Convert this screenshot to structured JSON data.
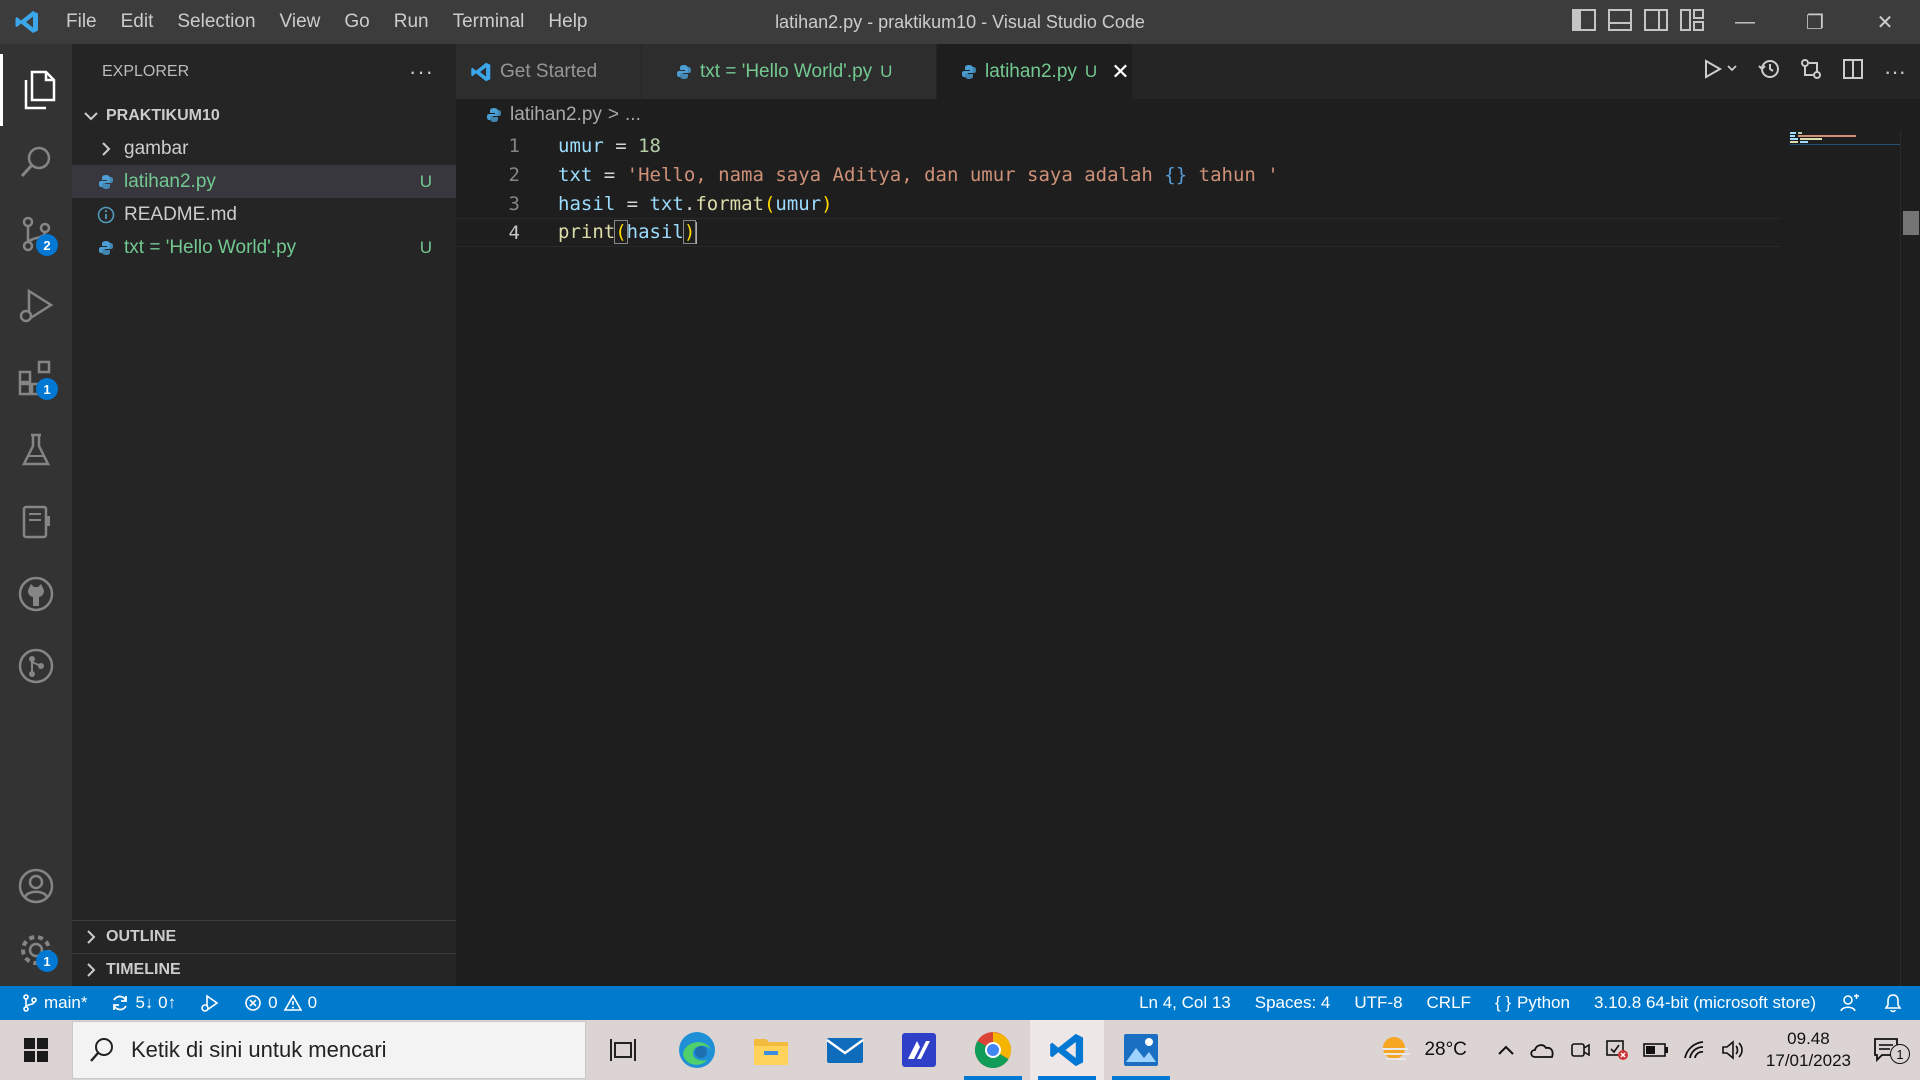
{
  "titlebar": {
    "menu": [
      "File",
      "Edit",
      "Selection",
      "View",
      "Go",
      "Run",
      "Terminal",
      "Help"
    ],
    "title": "latihan2.py - praktikum10 - Visual Studio Code",
    "window_controls": {
      "minimize": "—",
      "restore": "❐",
      "close": "✕"
    }
  },
  "activitybar": {
    "source_control_badge": "2",
    "extensions_badge": "1",
    "settings_badge": "1"
  },
  "sidebar": {
    "header": "EXPLORER",
    "more": "···",
    "root": "PRAKTIKUM10",
    "items": [
      {
        "label": "gambar",
        "status": ""
      },
      {
        "label": "latihan2.py",
        "status": "U"
      },
      {
        "label": "README.md",
        "status": ""
      },
      {
        "label": "txt = 'Hello World'.py",
        "status": "U"
      }
    ],
    "outline": "OUTLINE",
    "timeline": "TIMELINE"
  },
  "tabs": [
    {
      "label": "Get Started",
      "status": ""
    },
    {
      "label": "txt = 'Hello World'.py",
      "status": "U"
    },
    {
      "label": "latihan2.py",
      "status": "U",
      "close": "✕"
    }
  ],
  "breadcrumb": {
    "file": "latihan2.py",
    "separator": ">",
    "rest": "..."
  },
  "editor": {
    "line_numbers": [
      "1",
      "2",
      "3",
      "4"
    ],
    "lines": {
      "l1": {
        "var": "umur",
        "op": " = ",
        "num": "18"
      },
      "l2": {
        "var": "txt",
        "op": " = ",
        "str1": "'Hello, nama saya Aditya, dan umur saya adalah ",
        "ph": "{}",
        "str2": " tahun '"
      },
      "l3": {
        "var": "hasil",
        "op": " = ",
        "obj": "txt",
        "dot": ".",
        "fn": "format",
        "open": "(",
        "arg": "umur",
        "close": ")"
      },
      "l4": {
        "fn": "print",
        "open": "(",
        "arg": "hasil",
        "close": ")"
      }
    }
  },
  "statusbar": {
    "branch": "main*",
    "sync": "5↓ 0↑",
    "errors": "0",
    "warnings": "0",
    "position": "Ln 4, Col 13",
    "spaces": "Spaces: 4",
    "encoding": "UTF-8",
    "eol": "CRLF",
    "language": "Python",
    "interpreter": "3.10.8 64-bit (microsoft store)"
  },
  "taskbar": {
    "search_placeholder": "Ketik di sini untuk mencari",
    "weather": "28°C",
    "time": "09.48",
    "date": "17/01/2023",
    "notification_count": "1"
  },
  "colors": {
    "accent": "#007acc",
    "untracked": "#73c991",
    "editor_bg": "#1e1e1e"
  }
}
